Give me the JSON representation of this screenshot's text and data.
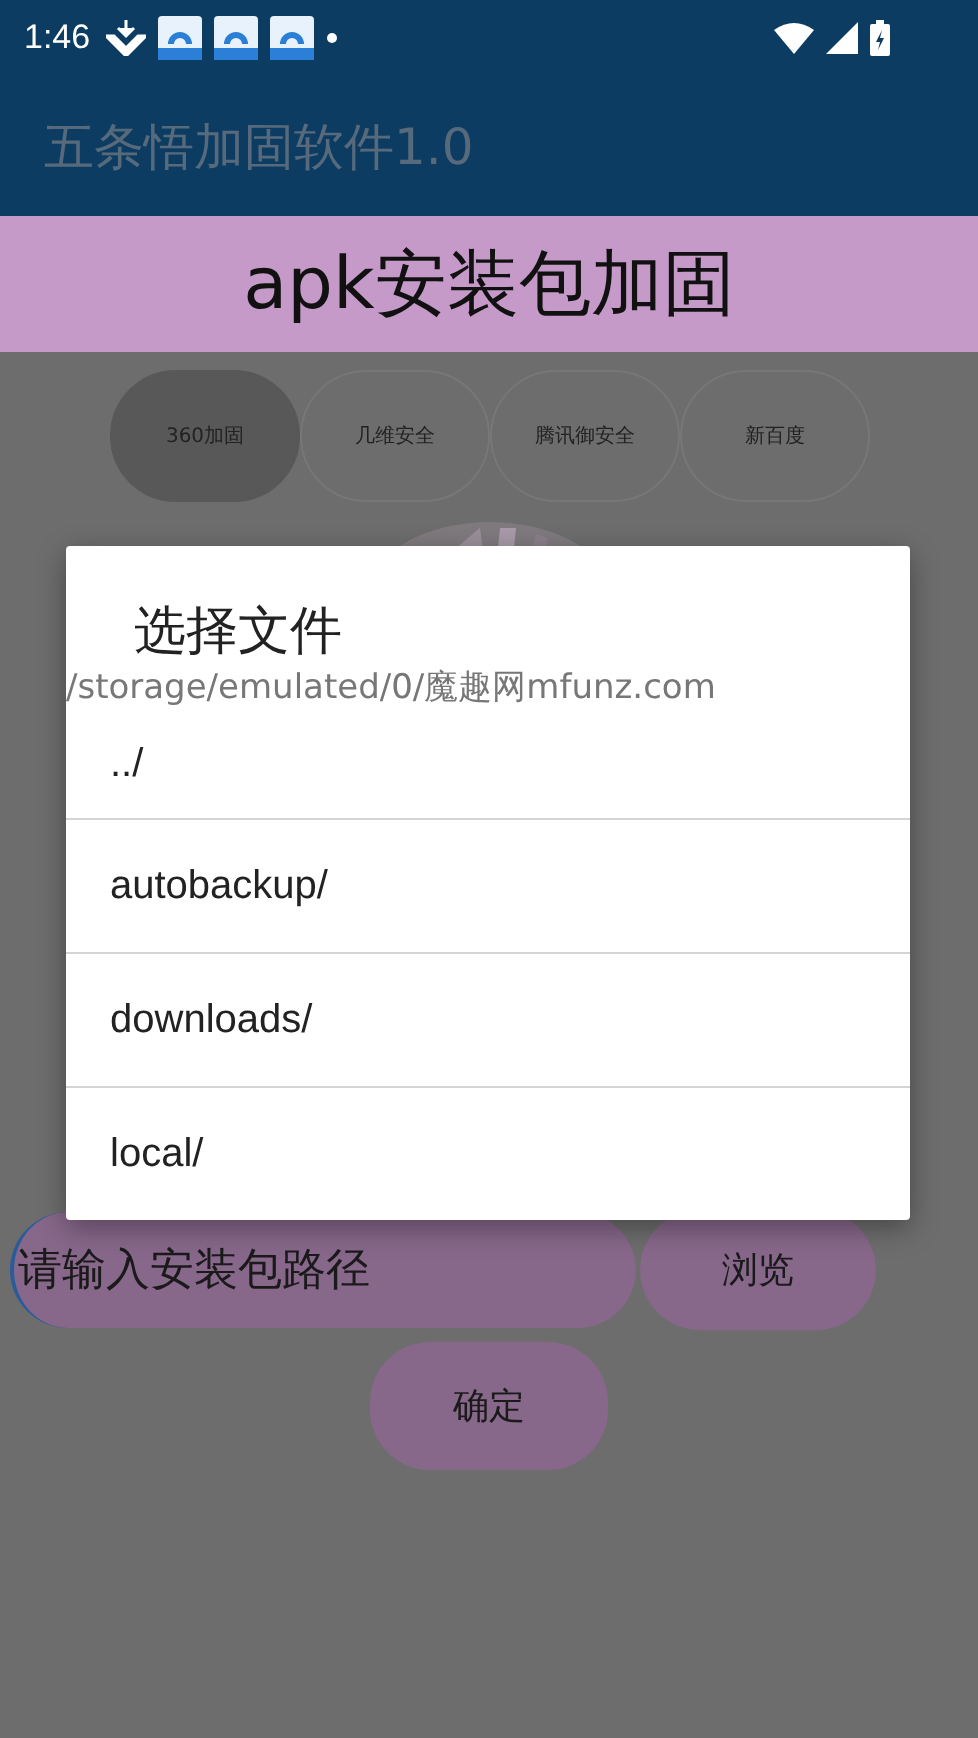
{
  "status_bar": {
    "time": "1:46"
  },
  "app_bar": {
    "title": "五条悟加固软件1.0"
  },
  "header": {
    "title": "apk安装包加固"
  },
  "engines": [
    {
      "label": "360加固",
      "selected": true
    },
    {
      "label": "几维安全",
      "selected": false
    },
    {
      "label": "腾讯御安全",
      "selected": false
    },
    {
      "label": "新百度",
      "selected": false
    }
  ],
  "path_field": {
    "value": "请输入安装包路径"
  },
  "browse_button": "浏览",
  "confirm_button": "确定",
  "dialog": {
    "title": "选择文件",
    "path": "/storage/emulated/0/魔趣网mfunz.com",
    "items": [
      {
        "label": "../"
      },
      {
        "label": "autobackup/"
      },
      {
        "label": "downloads/"
      },
      {
        "label": "local/"
      }
    ]
  }
}
